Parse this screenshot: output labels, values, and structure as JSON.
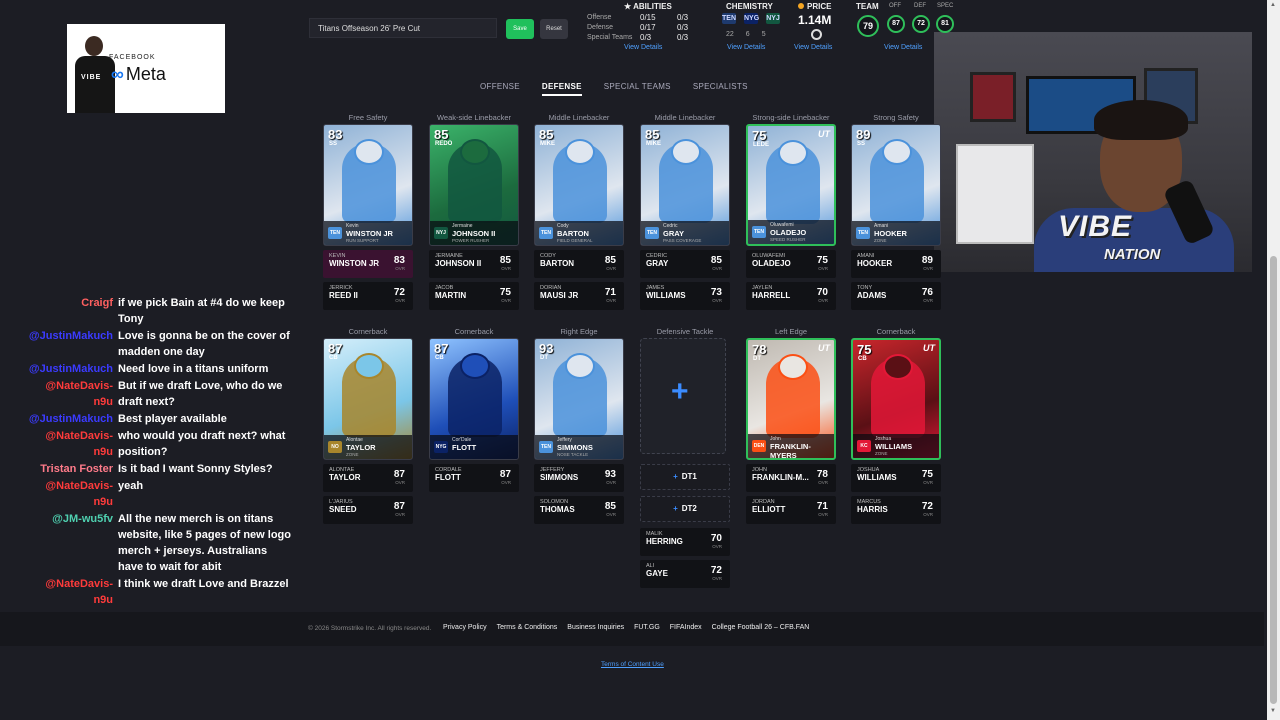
{
  "stream": {
    "meta_overlay": {
      "fb_label": "FACEBOOK",
      "brand": "Meta",
      "logo_text": "VIBE"
    },
    "webcam_logo": {
      "main": "VIBE",
      "sub": "NATION"
    }
  },
  "chat": [
    {
      "user": "Craigf",
      "color": "#ff6060",
      "message": "if we pick Bain at #4 do we keep Tony"
    },
    {
      "user": "@JustinMakuch",
      "color": "#3b3bff",
      "message": "Love is gonna be on the cover of madden one day"
    },
    {
      "user": "@JustinMakuch",
      "color": "#3b3bff",
      "message": "Need love in a titans uniform"
    },
    {
      "user": "@NateDavis-n9u",
      "color": "#ff3b3b",
      "message": "But if we draft Love, who do we draft next?"
    },
    {
      "user": "@JustinMakuch",
      "color": "#3b3bff",
      "message": "Best player available"
    },
    {
      "user": "@NateDavis-n9u",
      "color": "#ff3b3b",
      "message": "who would you draft next? what position?"
    },
    {
      "user": "Tristan Foster",
      "color": "#ff7b8a",
      "message": "Is it bad I want Sonny Styles?"
    },
    {
      "user": "@NateDavis-n9u",
      "color": "#ff3b3b",
      "message": "yeah"
    },
    {
      "user": "@JM-wu5fv",
      "color": "#4fd0b0",
      "message": "All the new merch is on titans website, like 5 pages of new logo merch + jerseys. Australians have to wait for abit"
    },
    {
      "user": "@NateDavis-n9u",
      "color": "#ff3b3b",
      "message": "I think we draft Love and Brazzel"
    }
  ],
  "toolbar": {
    "team_name": "Titans Offseason 26' Pre Cut",
    "save_label": "Save",
    "reset_label": "Reset"
  },
  "abilities": {
    "title": "ABILITIES",
    "rows": [
      {
        "label": "Offense",
        "a": "0/15",
        "b": "0/3"
      },
      {
        "label": "Defense",
        "a": "0/17",
        "b": "0/3"
      },
      {
        "label": "Special Teams",
        "a": "0/3",
        "b": "0/3"
      }
    ],
    "link": "View Details"
  },
  "chemistry": {
    "title": "CHEMISTRY",
    "teams": [
      "TEN",
      "NYG",
      "NYJ"
    ],
    "counts": [
      "22",
      "6",
      "5"
    ],
    "link": "View Details"
  },
  "price": {
    "title": "PRICE",
    "value": "1.14M",
    "link": "View Details"
  },
  "team_ratings": {
    "title": "TEAM",
    "overall": "79",
    "off_label": "OFF",
    "off": "87",
    "def_label": "DEF",
    "def": "72",
    "spec_label": "SPEC",
    "spec": "81",
    "link": "View Details"
  },
  "tabs": [
    "OFFENSE",
    "DEFENSE",
    "SPECIAL TEAMS",
    "SPECIALISTS"
  ],
  "active_tab": "DEFENSE",
  "lineup_row1": [
    {
      "pos_label": "Free Safety",
      "card": {
        "ovr": "83",
        "pos": "SS",
        "first": "Kevin",
        "last": "WINSTON JR",
        "role": "RUN SUPPORT",
        "ut": "",
        "team": "TEN"
      },
      "depth": [
        {
          "first": "KEVIN",
          "last": "WINSTON JR",
          "ovr": "83"
        },
        {
          "first": "JERRICK",
          "last": "REED II",
          "ovr": "72"
        }
      ]
    },
    {
      "pos_label": "Weak-side Linebacker",
      "card": {
        "ovr": "85",
        "pos": "REDO",
        "first": "Jermaine",
        "last": "JOHNSON II",
        "role": "POWER RUSHER",
        "ut": "",
        "team": "NYJ"
      },
      "depth": [
        {
          "first": "JERMAINE",
          "last": "JOHNSON II",
          "ovr": "85"
        },
        {
          "first": "JACOB",
          "last": "MARTIN",
          "ovr": "75"
        }
      ]
    },
    {
      "pos_label": "Middle Linebacker",
      "card": {
        "ovr": "85",
        "pos": "MIKE",
        "first": "Cody",
        "last": "BARTON",
        "role": "FIELD GENERAL",
        "ut": "",
        "team": "TEN"
      },
      "depth": [
        {
          "first": "CODY",
          "last": "BARTON",
          "ovr": "85"
        },
        {
          "first": "DORIAN",
          "last": "MAUSI JR",
          "ovr": "71"
        }
      ]
    },
    {
      "pos_label": "Middle Linebacker",
      "card": {
        "ovr": "85",
        "pos": "MIKE",
        "first": "Cedric",
        "last": "GRAY",
        "role": "PASS COVERAGE",
        "ut": "",
        "team": "TEN"
      },
      "depth": [
        {
          "first": "CEDRIC",
          "last": "GRAY",
          "ovr": "85"
        },
        {
          "first": "JAMES",
          "last": "WILLIAMS",
          "ovr": "73"
        }
      ]
    },
    {
      "pos_label": "Strong-side Linebacker",
      "card": {
        "ovr": "75",
        "pos": "LEDE",
        "first": "Oluwafemi",
        "last": "OLADEJO",
        "role": "SPEED RUSHER",
        "ut": "UT",
        "team": "TEN"
      },
      "depth": [
        {
          "first": "OLUWAFEMI",
          "last": "OLADEJO",
          "ovr": "75"
        },
        {
          "first": "JAYLEN",
          "last": "HARRELL",
          "ovr": "70"
        }
      ]
    },
    {
      "pos_label": "Strong Safety",
      "card": {
        "ovr": "89",
        "pos": "SS",
        "first": "Amani",
        "last": "HOOKER",
        "role": "ZONE",
        "ut": "",
        "team": "TEN"
      },
      "depth": [
        {
          "first": "AMANI",
          "last": "HOOKER",
          "ovr": "89"
        },
        {
          "first": "TONY",
          "last": "ADAMS",
          "ovr": "76"
        }
      ]
    }
  ],
  "lineup_row2": [
    {
      "pos_label": "Cornerback",
      "card": {
        "ovr": "87",
        "pos": "CB",
        "first": "Alontae",
        "last": "TAYLOR",
        "role": "ZONE",
        "ut": "",
        "team": "NO"
      },
      "depth": [
        {
          "first": "ALONTAE",
          "last": "TAYLOR",
          "ovr": "87"
        },
        {
          "first": "L'JARIUS",
          "last": "SNEED",
          "ovr": "87"
        }
      ]
    },
    {
      "pos_label": "Cornerback",
      "card": {
        "ovr": "87",
        "pos": "CB",
        "first": "Cor'Dale",
        "last": "FLOTT",
        "role": "",
        "ut": "",
        "team": "NYG"
      },
      "depth": [
        {
          "first": "CORDALE",
          "last": "FLOTT",
          "ovr": "87"
        }
      ]
    },
    {
      "pos_label": "Right Edge",
      "card": {
        "ovr": "93",
        "pos": "DT",
        "first": "Jeffery",
        "last": "SIMMONS",
        "role": "NOSE TACKLE",
        "ut": "",
        "team": "TEN"
      },
      "depth": [
        {
          "first": "JEFFERY",
          "last": "SIMMONS",
          "ovr": "93"
        },
        {
          "first": "SOLOMON",
          "last": "THOMAS",
          "ovr": "85"
        }
      ]
    },
    {
      "pos_label": "Defensive Tackle",
      "empty": true,
      "add": [
        "DT1",
        "DT2"
      ],
      "depth": [
        {
          "first": "MALIK",
          "last": "HERRING",
          "ovr": "70"
        },
        {
          "first": "ALI",
          "last": "GAYE",
          "ovr": "72"
        }
      ]
    },
    {
      "pos_label": "Left Edge",
      "card": {
        "ovr": "78",
        "pos": "DT",
        "first": "John",
        "last": "FRANKLIN-MYERS",
        "role": "NOSE TACKLE",
        "ut": "UT",
        "team": "DEN"
      },
      "depth": [
        {
          "first": "JOHN",
          "last": "FRANKLIN-M...",
          "ovr": "78"
        },
        {
          "first": "JORDAN",
          "last": "ELLIOTT",
          "ovr": "71"
        }
      ]
    },
    {
      "pos_label": "Cornerback",
      "card": {
        "ovr": "75",
        "pos": "CB",
        "first": "Joshua",
        "last": "WILLIAMS",
        "role": "ZONE",
        "ut": "UT",
        "team": "KC"
      },
      "depth": [
        {
          "first": "JOSHUA",
          "last": "WILLIAMS",
          "ovr": "75"
        },
        {
          "first": "MARCUS",
          "last": "HARRIS",
          "ovr": "72"
        }
      ]
    }
  ],
  "ovr_label": "OVR",
  "footer": {
    "copyright": "© 2026 Stormstrike Inc. All rights reserved.",
    "links": [
      "Privacy Policy",
      "Terms & Conditions",
      "Business Inquiries",
      "FUT.GG",
      "FIFAIndex",
      "College Football 26 – CFB.FAN"
    ],
    "terms": "Terms of Content Use"
  }
}
